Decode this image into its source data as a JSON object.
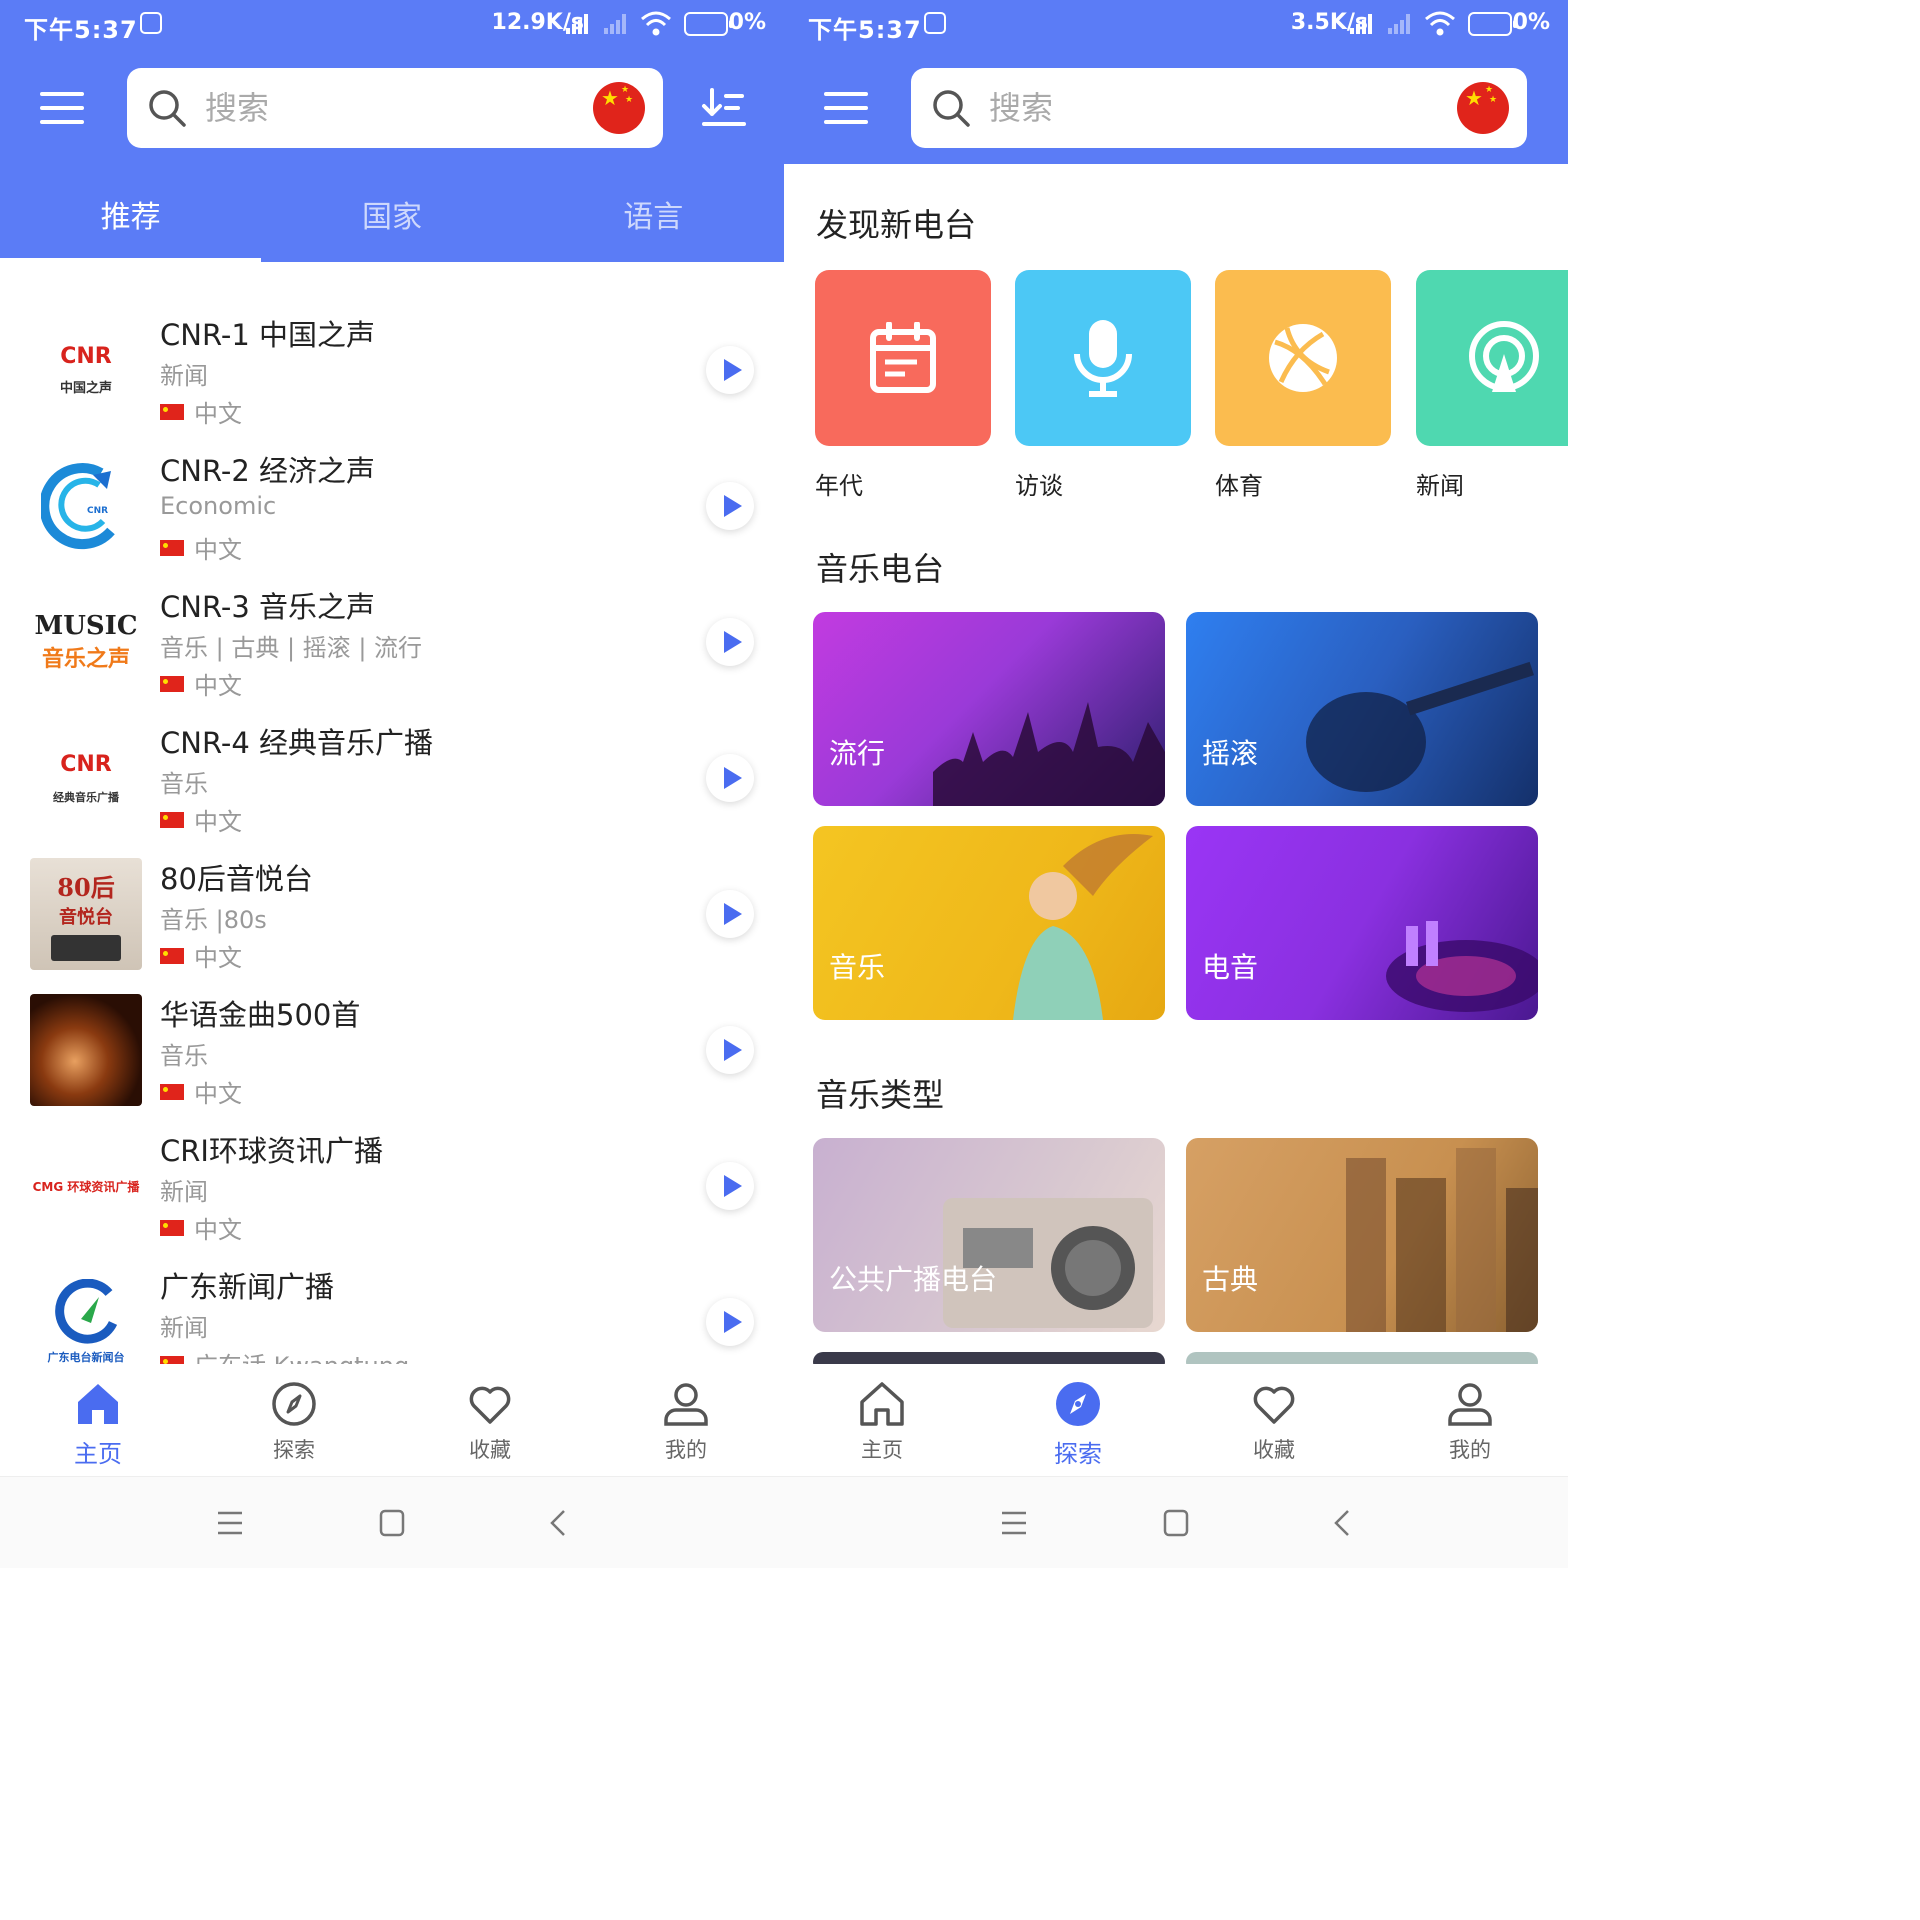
{
  "left": {
    "status": {
      "time": "下午5:37",
      "speed": "12.9K/s",
      "battery": "0%"
    },
    "search": {
      "placeholder": "搜索"
    },
    "tabs": [
      {
        "label": "推荐"
      },
      {
        "label": "国家"
      },
      {
        "label": "语言"
      }
    ],
    "stations": [
      {
        "name": "CNR-1 中国之声",
        "tags": "新闻",
        "lang": "中文",
        "logo": "CNR"
      },
      {
        "name": "CNR-2 经济之声",
        "tags": "Economic",
        "lang": "中文",
        "logo": "CNR"
      },
      {
        "name": "CNR-3 音乐之声",
        "tags": "音乐 | 古典 | 摇滚 | 流行",
        "lang": "中文",
        "logo": "MUSIC"
      },
      {
        "name": "CNR-4 经典音乐广播",
        "tags": "音乐",
        "lang": "中文",
        "logo": "CNR"
      },
      {
        "name": "80后音悦台",
        "tags": "音乐 |80s",
        "lang": "中文",
        "logo": "80后"
      },
      {
        "name": "华语金曲500首",
        "tags": "音乐",
        "lang": "中文",
        "logo": ""
      },
      {
        "name": "CRI环球资讯广播",
        "tags": "新闻",
        "lang": "中文",
        "logo": "CMG 环球资讯广播"
      },
      {
        "name": "广东新闻广播",
        "tags": "新闻",
        "lang": "广东话 Kwangtung",
        "logo": "广东电台新闻台"
      }
    ],
    "nav": [
      {
        "label": "主页"
      },
      {
        "label": "探索"
      },
      {
        "label": "收藏"
      },
      {
        "label": "我的"
      }
    ]
  },
  "right": {
    "status": {
      "time": "下午5:37",
      "speed": "3.5K/s",
      "battery": "0%"
    },
    "search": {
      "placeholder": "搜索"
    },
    "discover_title": "发现新电台",
    "categories": [
      {
        "label": "年代",
        "color": "#f86a5c",
        "icon": "calendar-icon"
      },
      {
        "label": "访谈",
        "color": "#4cc8f5",
        "icon": "microphone-icon"
      },
      {
        "label": "体育",
        "color": "#fbbc4f",
        "icon": "basketball-icon"
      },
      {
        "label": "新闻",
        "color": "#4fd8b0",
        "icon": "broadcast-icon"
      }
    ],
    "music_radio_title": "音乐电台",
    "music_radio": [
      {
        "label": "流行"
      },
      {
        "label": "摇滚"
      },
      {
        "label": "音乐"
      },
      {
        "label": "电音"
      }
    ],
    "music_type_title": "音乐类型",
    "music_type": [
      {
        "label": "公共广播电台"
      },
      {
        "label": "古典"
      }
    ],
    "nav": [
      {
        "label": "主页"
      },
      {
        "label": "探索"
      },
      {
        "label": "收藏"
      },
      {
        "label": "我的"
      }
    ]
  },
  "colors": {
    "primary": "#5b7cf6",
    "accent": "#4a6cf0"
  }
}
